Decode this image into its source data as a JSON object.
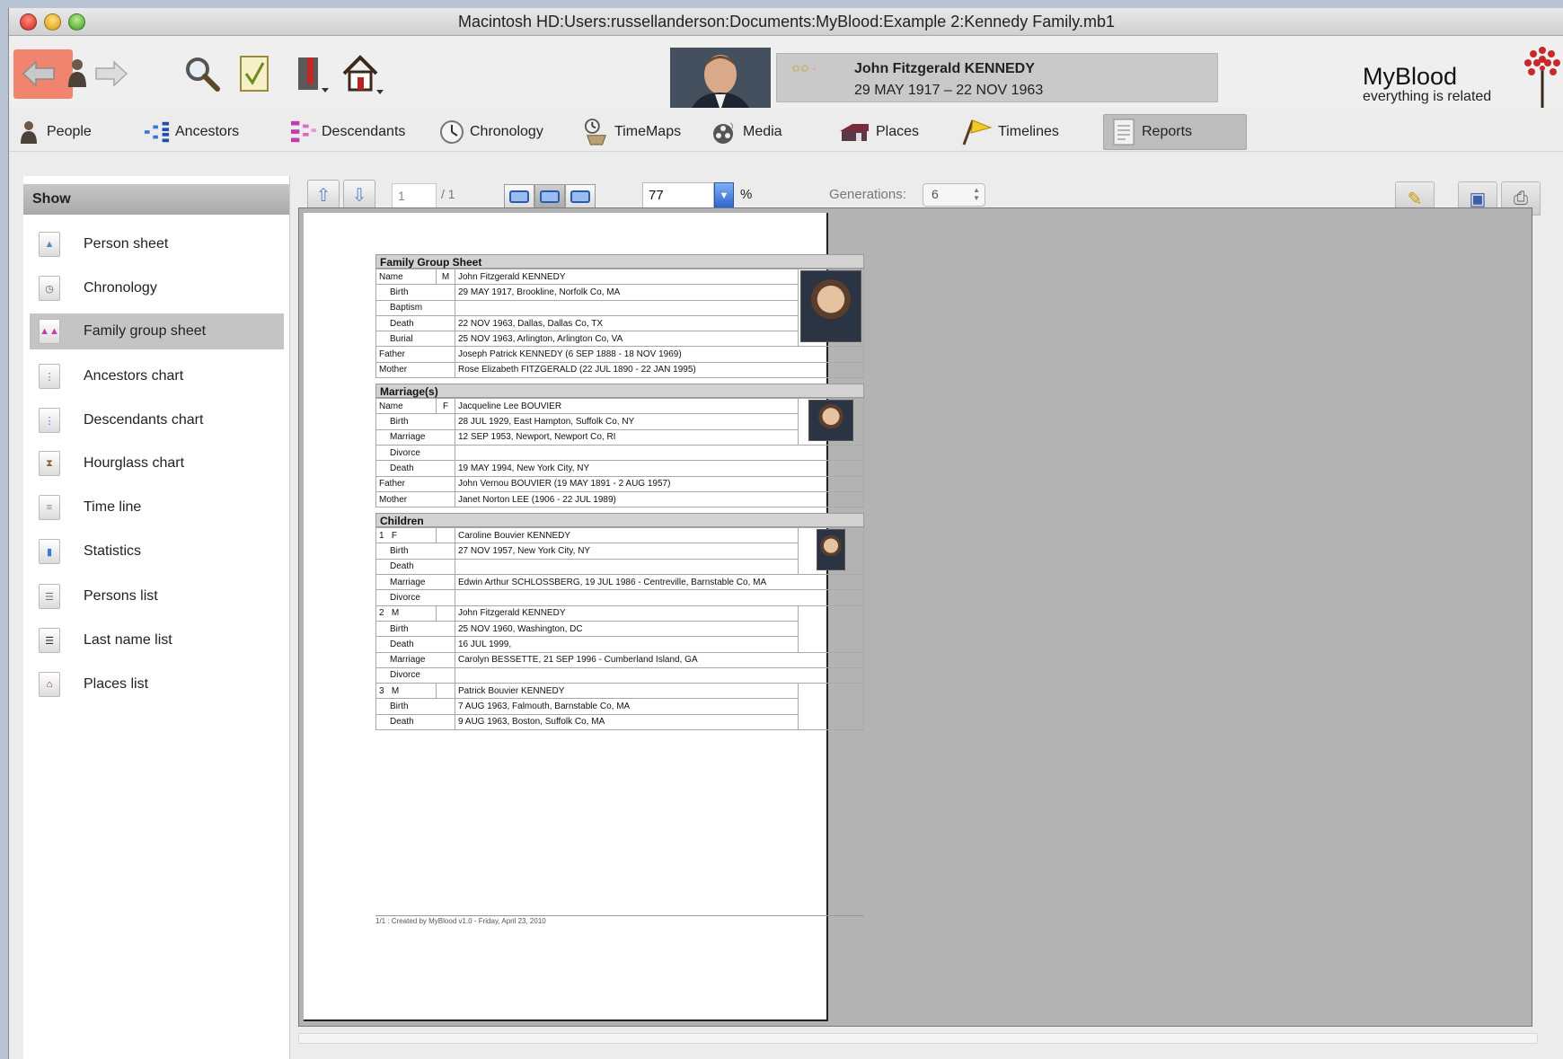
{
  "window": {
    "title": "Macintosh HD:Users:russellanderson:Documents:MyBlood:Example 2:Kennedy Family.mb1"
  },
  "header": {
    "person_name": "John Fitzgerald KENNEDY",
    "person_dates": "29 MAY 1917 – 22 NOV 1963",
    "rating": "✩✩ ·",
    "brand_name": "MyBlood",
    "brand_tagline": "everything is related"
  },
  "nav": {
    "items": [
      {
        "label": "People",
        "icon": "person-icon"
      },
      {
        "label": "Ancestors",
        "icon": "ancestors-icon"
      },
      {
        "label": "Descendants",
        "icon": "descendants-icon"
      },
      {
        "label": "Chronology",
        "icon": "clock-icon"
      },
      {
        "label": "TimeMaps",
        "icon": "timemaps-icon"
      },
      {
        "label": "Media",
        "icon": "film-reel-icon"
      },
      {
        "label": "Places",
        "icon": "house-icon"
      },
      {
        "label": "Timelines",
        "icon": "flag-icon"
      },
      {
        "label": "Reports",
        "icon": "report-icon",
        "active": true
      }
    ]
  },
  "sidebar": {
    "header": "Show",
    "items": [
      {
        "label": "Person sheet"
      },
      {
        "label": "Chronology"
      },
      {
        "label": "Family group sheet",
        "active": true
      },
      {
        "label": "Ancestors chart"
      },
      {
        "label": "Descendants chart"
      },
      {
        "label": "Hourglass chart"
      },
      {
        "label": "Time line"
      },
      {
        "label": "Statistics"
      },
      {
        "label": "Persons list"
      },
      {
        "label": "Last name list"
      },
      {
        "label": "Places list"
      }
    ]
  },
  "report_toolbar": {
    "page": "1",
    "page_total": "/ 1",
    "zoom": "77",
    "zoom_unit": "%",
    "generations_label": "Generations:",
    "generations": "6"
  },
  "sheet": {
    "title": "Family Group Sheet",
    "person": {
      "name_label": "Name",
      "sex": "M",
      "name": "John Fitzgerald KENNEDY",
      "birth_label": "Birth",
      "birth": "29 MAY 1917, Brookline, Norfolk Co, MA",
      "baptism_label": "Baptism",
      "baptism": "",
      "death_label": "Death",
      "death": "22 NOV 1963, Dallas, Dallas Co, TX",
      "burial_label": "Burial",
      "burial": "25 NOV 1963, Arlington, Arlington Co, VA",
      "father_label": "Father",
      "father": "Joseph Patrick KENNEDY (6 SEP 1888 - 18 NOV 1969)",
      "mother_label": "Mother",
      "mother": "Rose Elizabeth FITZGERALD (22 JUL 1890 - 22 JAN 1995)"
    },
    "marriages_title": "Marriage(s)",
    "spouse": {
      "name_label": "Name",
      "sex": "F",
      "name": "Jacqueline Lee BOUVIER",
      "birth_label": "Birth",
      "birth": "28 JUL 1929, East Hampton, Suffolk Co, NY",
      "marriage_label": "Marriage",
      "marriage": "12 SEP 1953, Newport, Newport Co, RI",
      "divorce_label": "Divorce",
      "divorce": "",
      "death_label": "Death",
      "death": "19 MAY 1994, New York City, NY",
      "father_label": "Father",
      "father": "John Vernou BOUVIER (19 MAY 1891 - 2 AUG 1957)",
      "mother_label": "Mother",
      "mother": "Janet Norton LEE (1906 - 22 JUL 1989)"
    },
    "children_title": "Children",
    "children": [
      {
        "num": "1",
        "sex": "F",
        "name": "Caroline Bouvier KENNEDY",
        "birth_label": "Birth",
        "birth": "27 NOV 1957, New York City, NY",
        "death_label": "Death",
        "death": "",
        "marriage_label": "Marriage",
        "marriage": "Edwin Arthur SCHLOSSBERG, 19 JUL 1986 - Centreville, Barnstable Co, MA",
        "divorce_label": "Divorce",
        "divorce": ""
      },
      {
        "num": "2",
        "sex": "M",
        "name": "John Fitzgerald KENNEDY",
        "birth_label": "Birth",
        "birth": "25 NOV 1960, Washington, DC",
        "death_label": "Death",
        "death": "16 JUL 1999,",
        "marriage_label": "Marriage",
        "marriage": "Carolyn BESSETTE, 21 SEP 1996 - Cumberland Island, GA",
        "divorce_label": "Divorce",
        "divorce": ""
      },
      {
        "num": "3",
        "sex": "M",
        "name": "Patrick Bouvier KENNEDY",
        "birth_label": "Birth",
        "birth": "7 AUG 1963, Falmouth, Barnstable Co, MA",
        "death_label": "Death",
        "death": "9 AUG 1963, Boston, Suffolk Co, MA"
      }
    ],
    "footer": "1/1 : Created by MyBlood v1.0 - Friday, April 23, 2010"
  }
}
